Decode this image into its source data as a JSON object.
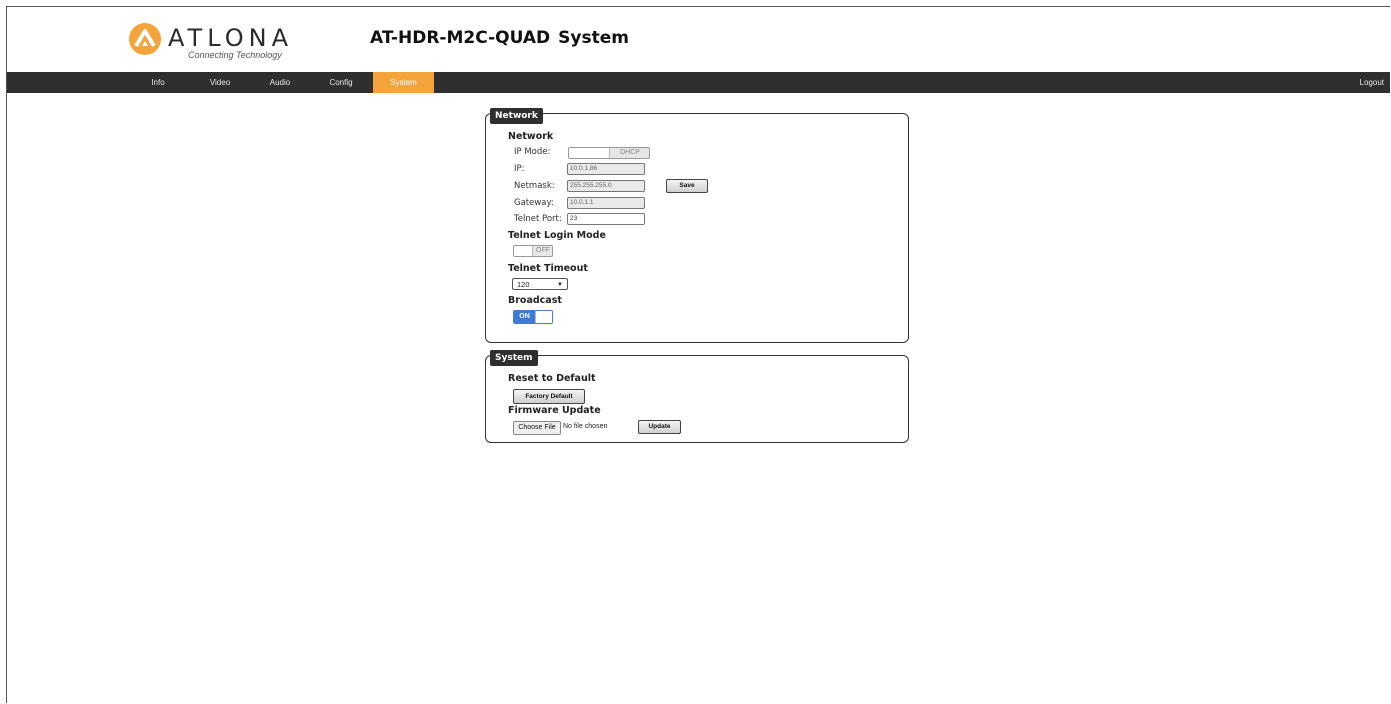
{
  "header": {
    "brand": "ATLONA",
    "tagline": "Connecting Technology",
    "model": "AT-HDR-M2C-QUAD",
    "page": "System"
  },
  "nav": {
    "items": [
      {
        "label": "Info"
      },
      {
        "label": "Video"
      },
      {
        "label": "Audio"
      },
      {
        "label": "Config"
      },
      {
        "label": "System"
      }
    ],
    "active": "System",
    "logout": "Logout"
  },
  "network_panel": {
    "legend": "Network",
    "section_title": "Network",
    "ip_mode": {
      "label": "IP Mode:",
      "value": "DHCP"
    },
    "ip": {
      "label": "IP:",
      "value": "10.0.1.86"
    },
    "netmask": {
      "label": "Netmask:",
      "value": "255.255.255.0"
    },
    "gateway": {
      "label": "Gateway:",
      "value": "10.0.1.1"
    },
    "telnet_port": {
      "label": "Telnet Port:",
      "value": "23"
    },
    "save_label": "Save",
    "telnet_login_mode": {
      "title": "Telnet Login Mode",
      "value": "OFF"
    },
    "telnet_timeout": {
      "title": "Telnet Timeout",
      "value": "120"
    },
    "broadcast": {
      "title": "Broadcast",
      "value": "ON"
    }
  },
  "system_panel": {
    "legend": "System",
    "reset_title": "Reset to Default",
    "factory_default_label": "Factory Default",
    "firmware_title": "Firmware Update",
    "choose_file_label": "Choose File",
    "file_status": "No file chosen",
    "update_label": "Update"
  },
  "colors": {
    "navbar": "#2f2f2f",
    "active_tab": "#f4a43a",
    "toggle_on": "#3d7bd8",
    "logo_orange": "#f4a43a"
  }
}
